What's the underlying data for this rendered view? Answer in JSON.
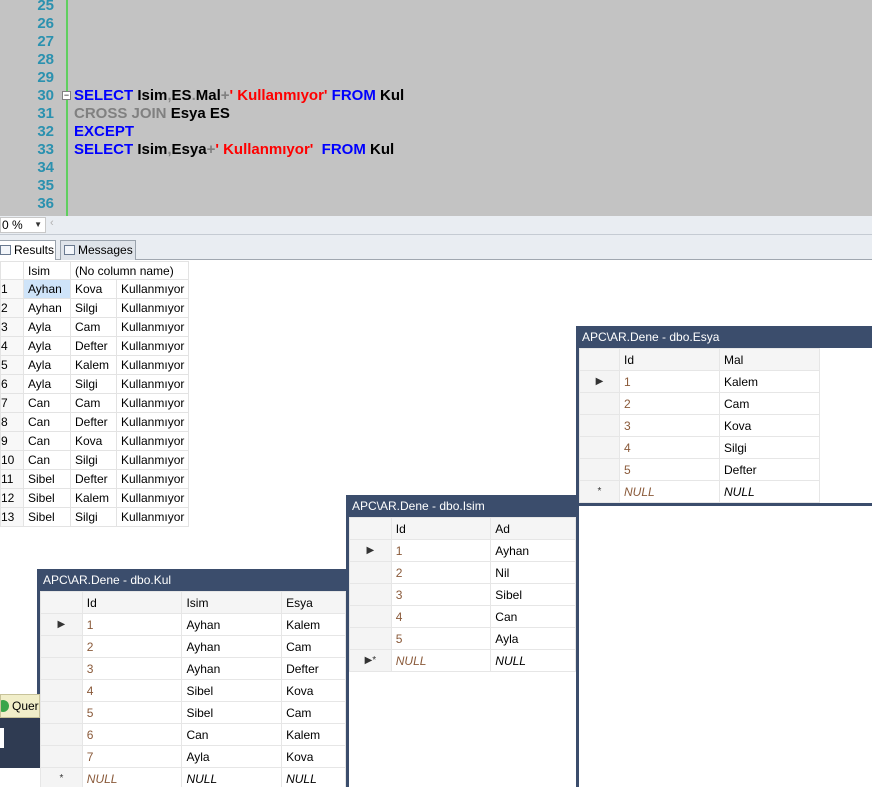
{
  "editor": {
    "lines": [
      {
        "n": "25",
        "tokens": []
      },
      {
        "n": "26",
        "tokens": []
      },
      {
        "n": "27",
        "tokens": []
      },
      {
        "n": "28",
        "tokens": []
      },
      {
        "n": "29",
        "tokens": []
      },
      {
        "n": "30",
        "fold": "−",
        "tokens": [
          {
            "t": "SELECT",
            "c": "kw"
          },
          {
            "t": " Isim",
            "c": ""
          },
          {
            "t": ",",
            "c": "gr"
          },
          {
            "t": "ES",
            "c": ""
          },
          {
            "t": ".",
            "c": "gr"
          },
          {
            "t": "Mal",
            "c": ""
          },
          {
            "t": "+",
            "c": "gr"
          },
          {
            "t": "' Kullanmıyor'",
            "c": "str"
          },
          {
            "t": " FROM",
            "c": "kw"
          },
          {
            "t": " Kul",
            "c": ""
          }
        ]
      },
      {
        "n": "31",
        "tokens": [
          {
            "t": "CROSS JOIN",
            "c": "gr"
          },
          {
            "t": " Esya ES",
            "c": ""
          }
        ]
      },
      {
        "n": "32",
        "tokens": [
          {
            "t": "EXCEPT",
            "c": "kw"
          }
        ]
      },
      {
        "n": "33",
        "tokens": [
          {
            "t": "SELECT",
            "c": "kw"
          },
          {
            "t": " Isim",
            "c": ""
          },
          {
            "t": ",",
            "c": "gr"
          },
          {
            "t": "Esya",
            "c": ""
          },
          {
            "t": "+",
            "c": "gr"
          },
          {
            "t": "' Kullanmıyor'",
            "c": "str"
          },
          {
            "t": "  FROM",
            "c": "kw"
          },
          {
            "t": " Kul",
            "c": ""
          }
        ]
      },
      {
        "n": "34",
        "tokens": []
      },
      {
        "n": "35",
        "tokens": []
      },
      {
        "n": "36",
        "tokens": []
      }
    ]
  },
  "zoom": {
    "value": "0 %",
    "dropdown_icon": "chevron-down-icon"
  },
  "tabs": {
    "results_label": "Results",
    "messages_label": "Messages"
  },
  "results": {
    "headers": [
      "Isim",
      "(No column name)"
    ],
    "rows": [
      {
        "n": "1",
        "isim": "Ayhan",
        "mal": "Kova",
        "status": "Kullanmıyor"
      },
      {
        "n": "2",
        "isim": "Ayhan",
        "mal": "Silgi",
        "status": "Kullanmıyor"
      },
      {
        "n": "3",
        "isim": "Ayla",
        "mal": "Cam",
        "status": "Kullanmıyor"
      },
      {
        "n": "4",
        "isim": "Ayla",
        "mal": "Defter",
        "status": "Kullanmıyor"
      },
      {
        "n": "5",
        "isim": "Ayla",
        "mal": "Kalem",
        "status": "Kullanmıyor"
      },
      {
        "n": "6",
        "isim": "Ayla",
        "mal": "Silgi",
        "status": "Kullanmıyor"
      },
      {
        "n": "7",
        "isim": "Can",
        "mal": "Cam",
        "status": "Kullanmıyor"
      },
      {
        "n": "8",
        "isim": "Can",
        "mal": "Defter",
        "status": "Kullanmıyor"
      },
      {
        "n": "9",
        "isim": "Can",
        "mal": "Kova",
        "status": "Kullanmıyor"
      },
      {
        "n": "10",
        "isim": "Can",
        "mal": "Silgi",
        "status": "Kullanmıyor"
      },
      {
        "n": "11",
        "isim": "Sibel",
        "mal": "Defter",
        "status": "Kullanmıyor"
      },
      {
        "n": "12",
        "isim": "Sibel",
        "mal": "Kalem",
        "status": "Kullanmıyor"
      },
      {
        "n": "13",
        "isim": "Sibel",
        "mal": "Silgi",
        "status": "Kullanmıyor"
      }
    ]
  },
  "win_esya": {
    "title": "APC\\AR.Dene - dbo.Esya",
    "headers": [
      "Id",
      "Mal"
    ],
    "rows": [
      [
        "1",
        "Kalem"
      ],
      [
        "2",
        "Cam"
      ],
      [
        "3",
        "Kova"
      ],
      [
        "4",
        "Silgi"
      ],
      [
        "5",
        "Defter"
      ]
    ],
    "new_row": [
      "NULL",
      "NULL"
    ]
  },
  "win_isim": {
    "title": "APC\\AR.Dene - dbo.Isim",
    "headers": [
      "Id",
      "Ad"
    ],
    "rows": [
      [
        "1",
        "Ayhan"
      ],
      [
        "2",
        "Nil"
      ],
      [
        "3",
        "Sibel"
      ],
      [
        "4",
        "Can"
      ],
      [
        "5",
        "Ayla"
      ]
    ],
    "new_row": [
      "NULL",
      "NULL"
    ]
  },
  "win_kul": {
    "title": "APC\\AR.Dene - dbo.Kul",
    "headers": [
      "Id",
      "Isim",
      "Esya"
    ],
    "rows": [
      [
        "1",
        "Ayhan",
        "Kalem"
      ],
      [
        "2",
        "Ayhan",
        "Cam"
      ],
      [
        "3",
        "Ayhan",
        "Defter"
      ],
      [
        "4",
        "Sibel",
        "Kova"
      ],
      [
        "5",
        "Sibel",
        "Cam"
      ],
      [
        "6",
        "Can",
        "Kalem"
      ],
      [
        "7",
        "Ayla",
        "Kova"
      ]
    ],
    "new_row": [
      "NULL",
      "NULL",
      "NULL"
    ]
  },
  "query_chip": {
    "label": "Quer"
  }
}
